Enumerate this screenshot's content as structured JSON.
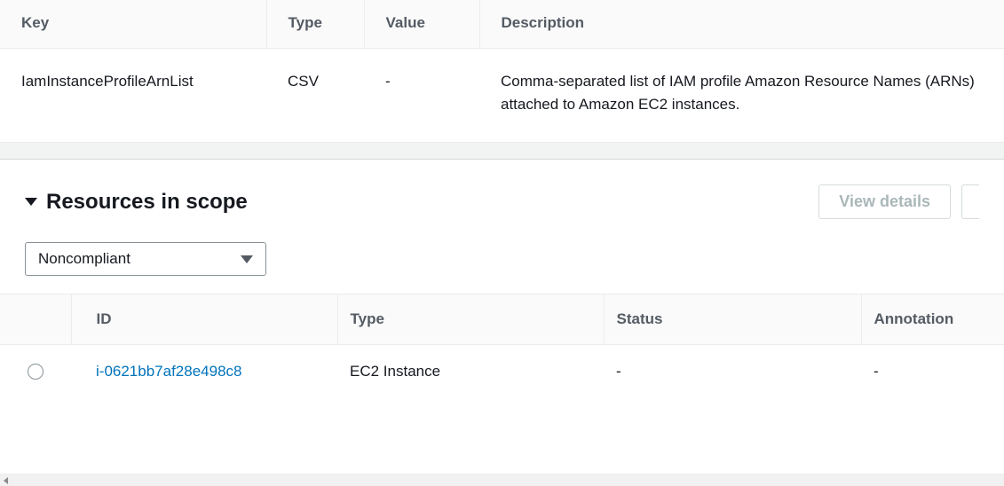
{
  "parameters_table": {
    "headers": {
      "key": "Key",
      "type": "Type",
      "value": "Value",
      "description": "Description"
    },
    "rows": [
      {
        "key": "IamInstanceProfileArnList",
        "type": "CSV",
        "value": "-",
        "description": "Comma-separated list of IAM profile Amazon Resource Names (ARNs) attached to Amazon EC2 instances."
      }
    ]
  },
  "resources_section": {
    "title": "Resources in scope",
    "view_details_label": "View details",
    "filter_selected": "Noncompliant",
    "table_headers": {
      "id": "ID",
      "type": "Type",
      "status": "Status",
      "annotation": "Annotation"
    },
    "rows": [
      {
        "id": "i-0621bb7af28e498c8",
        "type": "EC2 Instance",
        "status": "-",
        "annotation": "-"
      }
    ]
  }
}
